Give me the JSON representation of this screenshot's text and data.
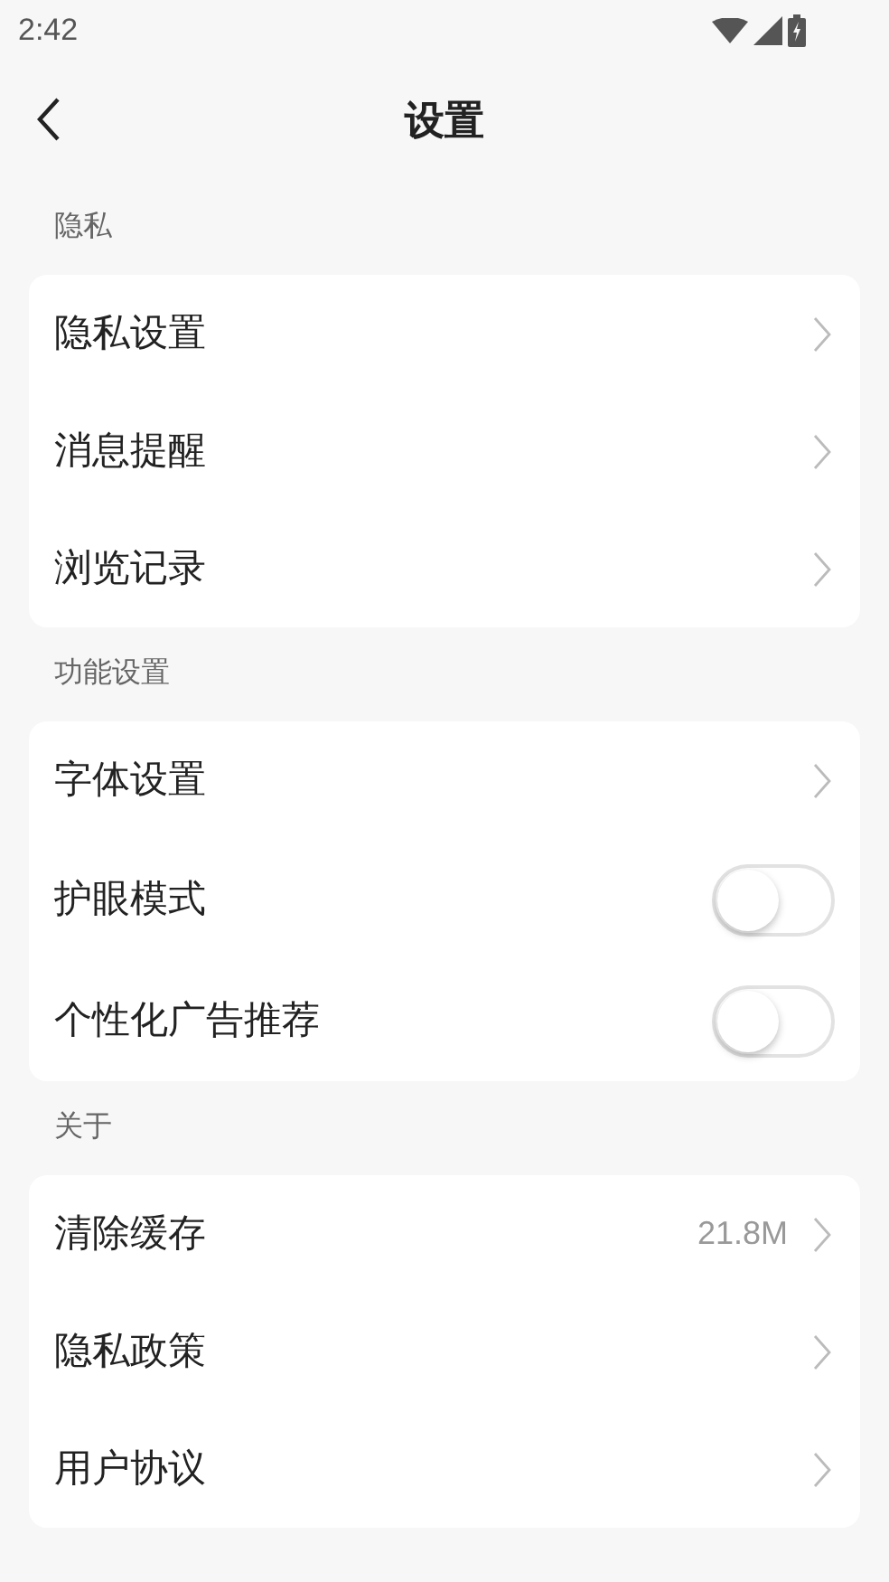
{
  "status_bar": {
    "time": "2:42"
  },
  "header": {
    "title": "设置"
  },
  "sections": [
    {
      "title": "隐私",
      "items": [
        {
          "kind": "link",
          "label": "隐私设置"
        },
        {
          "kind": "link",
          "label": "消息提醒"
        },
        {
          "kind": "link",
          "label": "浏览记录"
        }
      ]
    },
    {
      "title": "功能设置",
      "items": [
        {
          "kind": "link",
          "label": "字体设置"
        },
        {
          "kind": "toggle",
          "label": "护眼模式",
          "on": false
        },
        {
          "kind": "toggle",
          "label": "个性化广告推荐",
          "on": false
        }
      ]
    },
    {
      "title": "关于",
      "items": [
        {
          "kind": "link",
          "label": "清除缓存",
          "value": "21.8M"
        },
        {
          "kind": "link",
          "label": "隐私政策"
        },
        {
          "kind": "link",
          "label": "用户协议"
        }
      ]
    }
  ]
}
